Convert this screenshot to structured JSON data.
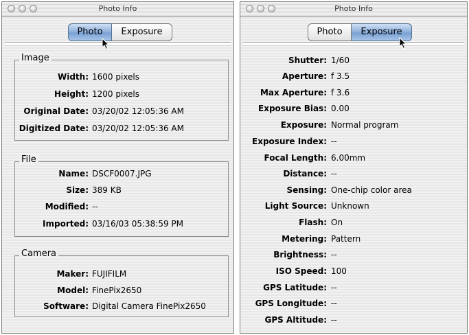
{
  "left_window": {
    "title": "Photo Info",
    "tabs": [
      {
        "label": "Photo",
        "active": true
      },
      {
        "label": "Exposure",
        "active": false
      }
    ],
    "groups": [
      {
        "label": "Image",
        "rows": [
          {
            "key": "Width:",
            "value": "1600 pixels"
          },
          {
            "key": "Height:",
            "value": "1200 pixels"
          },
          {
            "key": "Original Date:",
            "value": "03/20/02  12:05:36 AM"
          },
          {
            "key": "Digitized Date:",
            "value": "03/20/02  12:05:36 AM"
          }
        ]
      },
      {
        "label": "File",
        "rows": [
          {
            "key": "Name:",
            "value": "DSCF0007.JPG"
          },
          {
            "key": "Size:",
            "value": "389 KB"
          },
          {
            "key": "Modified:",
            "value": "--"
          },
          {
            "key": "Imported:",
            "value": "03/16/03  05:38:59 PM"
          }
        ]
      },
      {
        "label": "Camera",
        "rows": [
          {
            "key": "Maker:",
            "value": "FUJIFILM"
          },
          {
            "key": "Model:",
            "value": "FinePix2650"
          },
          {
            "key": "Software:",
            "value": "Digital Camera FinePix2650"
          }
        ]
      }
    ]
  },
  "right_window": {
    "title": "Photo Info",
    "tabs": [
      {
        "label": "Photo",
        "active": false
      },
      {
        "label": "Exposure",
        "active": true
      }
    ],
    "rows": [
      {
        "key": "Shutter:",
        "value": "1/60"
      },
      {
        "key": "Aperture:",
        "value": "f 3.5"
      },
      {
        "key": "Max Aperture:",
        "value": "f 3.6"
      },
      {
        "key": "Exposure Bias:",
        "value": "0.00"
      },
      {
        "key": "Exposure:",
        "value": "Normal program"
      },
      {
        "key": "Exposure Index:",
        "value": "--"
      },
      {
        "key": "Focal Length:",
        "value": "6.00mm"
      },
      {
        "key": "Distance:",
        "value": "--"
      },
      {
        "key": "Sensing:",
        "value": "One-chip color area"
      },
      {
        "key": "Light Source:",
        "value": "Unknown"
      },
      {
        "key": "Flash:",
        "value": "On"
      },
      {
        "key": "Metering:",
        "value": "Pattern"
      },
      {
        "key": "Brightness:",
        "value": "--"
      },
      {
        "key": "ISO Speed:",
        "value": "100"
      },
      {
        "key": "GPS Latitude:",
        "value": "--"
      },
      {
        "key": "GPS Longitude:",
        "value": "--"
      },
      {
        "key": "GPS Altitude:",
        "value": "--"
      }
    ]
  },
  "icons": {
    "traffic_lights": [
      "close-button",
      "minimize-button",
      "zoom-button"
    ],
    "pointer": "mouse-pointer-icon"
  }
}
